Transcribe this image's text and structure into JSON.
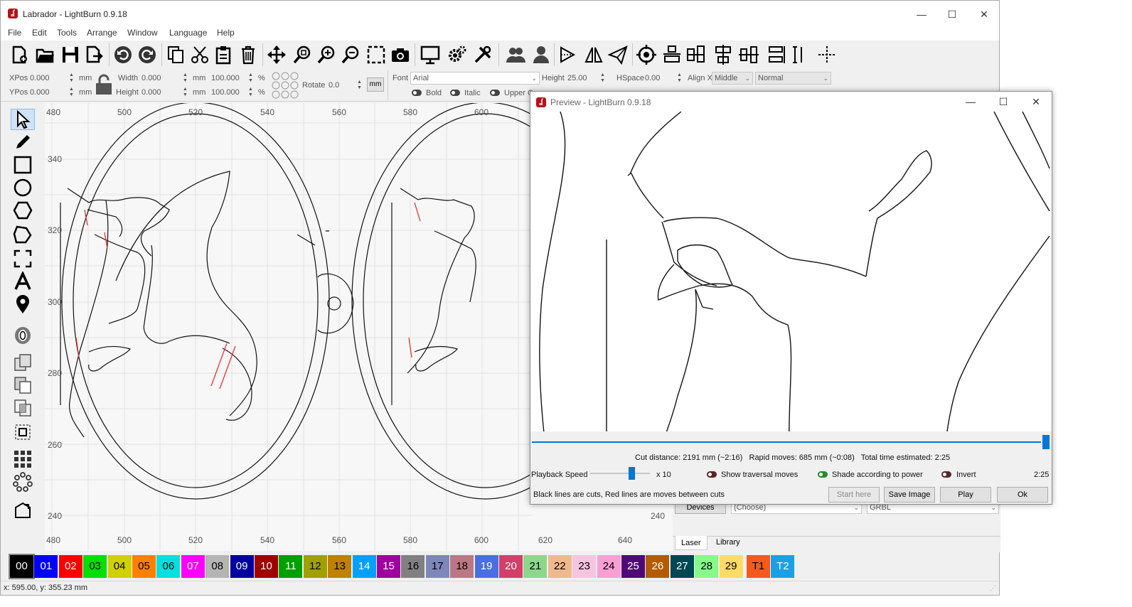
{
  "app": {
    "title": "Labrador - LightBurn 0.9.18",
    "icon": "lightburn-logo-icon",
    "window_controls": [
      "minimize-icon",
      "maximize-icon",
      "close-icon"
    ]
  },
  "menu": [
    "File",
    "Edit",
    "Tools",
    "Arrange",
    "Window",
    "Language",
    "Help"
  ],
  "toolbar_icons": [
    "new-file-icon",
    "open-folder-icon",
    "save-icon",
    "export-icon",
    "undo-icon",
    "redo-icon",
    "copy-icon",
    "cut-icon",
    "paste-icon",
    "delete-icon",
    "move-icon",
    "zoom-to-page-icon",
    "zoom-in-icon",
    "zoom-out-icon",
    "select-frame-icon",
    "camera-icon",
    "monitor-icon",
    "settings-icon",
    "tools-icon",
    "group-icon",
    "ungroup-icon",
    "mirror-horizontal-icon",
    "mirror-vertical-icon",
    "send-icon",
    "target-icon",
    "align-left-icon",
    "align-center-icon",
    "align-right-icon",
    "align-top-icon",
    "distribute-icon",
    "dock-icon"
  ],
  "props": {
    "xpos_label": "XPos",
    "xpos_value": "0.000",
    "xpos_unit": "mm",
    "ypos_label": "YPos",
    "ypos_value": "0.000",
    "ypos_unit": "mm",
    "width_label": "Width",
    "width_value": "0.000",
    "width_unit": "mm",
    "width_pct": "100.000",
    "pct": "%",
    "height_label": "Height",
    "height_value": "0.000",
    "height_unit": "mm",
    "height_pct": "100.000",
    "rotate_label": "Rotate",
    "rotate_value": "0.0",
    "unit_button": "mm",
    "font_label": "Font",
    "font_value": "Arial",
    "font_height_label": "Height",
    "font_height_value": "25.00",
    "hspace_label": "HSpace",
    "hspace_value": "0.00",
    "alignx_label": "Align X",
    "alignx_value": "Middle",
    "style_value": "Normal",
    "bold_label": "Bold",
    "italic_label": "Italic",
    "upper_label": "Upper C"
  },
  "left_tools": [
    "select-arrow-icon",
    "pencil-icon",
    "rectangle-icon",
    "ellipse-icon",
    "polygon-icon",
    "polygon-edit-icon",
    "frame-icon",
    "text-icon",
    "position-pin-icon",
    "offset-icon",
    "boolean-union-icon",
    "boolean-subtract-icon",
    "boolean-intersect-icon",
    "weld-icon",
    "grid-array-icon",
    "circular-array-icon",
    "edit-nodes-icon"
  ],
  "ruler": {
    "x_top": [
      "480",
      "500",
      "520",
      "540",
      "560",
      "580",
      "600"
    ],
    "x_bottom": [
      "480",
      "500",
      "520",
      "540",
      "560",
      "580",
      "600",
      "620",
      "640"
    ],
    "y": [
      "340",
      "320",
      "300",
      "280",
      "260",
      "240"
    ],
    "y_right": "240"
  },
  "palette": [
    {
      "label": "00",
      "bg": "#000000",
      "fg": "#ffffff"
    },
    {
      "label": "01",
      "bg": "#0000ff",
      "fg": "#ffffff"
    },
    {
      "label": "02",
      "bg": "#ff0000",
      "fg": "#ffffff"
    },
    {
      "label": "03",
      "bg": "#00e000",
      "fg": "#000000"
    },
    {
      "label": "04",
      "bg": "#d0d000",
      "fg": "#000000"
    },
    {
      "label": "05",
      "bg": "#ff8000",
      "fg": "#000000"
    },
    {
      "label": "06",
      "bg": "#00e0e0",
      "fg": "#000000"
    },
    {
      "label": "07",
      "bg": "#ff00ff",
      "fg": "#ffffff"
    },
    {
      "label": "08",
      "bg": "#b4b4b4",
      "fg": "#000000"
    },
    {
      "label": "09",
      "bg": "#0000a0",
      "fg": "#ffffff"
    },
    {
      "label": "10",
      "bg": "#a00000",
      "fg": "#ffffff"
    },
    {
      "label": "11",
      "bg": "#00a000",
      "fg": "#ffffff"
    },
    {
      "label": "12",
      "bg": "#a0a000",
      "fg": "#000000"
    },
    {
      "label": "13",
      "bg": "#c08000",
      "fg": "#000000"
    },
    {
      "label": "14",
      "bg": "#00a0ff",
      "fg": "#ffffff"
    },
    {
      "label": "15",
      "bg": "#a000a0",
      "fg": "#ffffff"
    },
    {
      "label": "16",
      "bg": "#808080",
      "fg": "#000000"
    },
    {
      "label": "17",
      "bg": "#7d87b9",
      "fg": "#000000"
    },
    {
      "label": "18",
      "bg": "#bb7784",
      "fg": "#000000"
    },
    {
      "label": "19",
      "bg": "#4a6fe3",
      "fg": "#ffffff"
    },
    {
      "label": "20",
      "bg": "#d33f6a",
      "fg": "#ffffff"
    },
    {
      "label": "21",
      "bg": "#8cd78c",
      "fg": "#000000"
    },
    {
      "label": "22",
      "bg": "#f0b98d",
      "fg": "#000000"
    },
    {
      "label": "23",
      "bg": "#f6c4e1",
      "fg": "#000000"
    },
    {
      "label": "24",
      "bg": "#fa9ed4",
      "fg": "#000000"
    },
    {
      "label": "25",
      "bg": "#500a78",
      "fg": "#ffffff"
    },
    {
      "label": "26",
      "bg": "#b45a00",
      "fg": "#ffffff"
    },
    {
      "label": "27",
      "bg": "#004754",
      "fg": "#ffffff"
    },
    {
      "label": "28",
      "bg": "#86fa88",
      "fg": "#000000"
    },
    {
      "label": "29",
      "bg": "#ffdb66",
      "fg": "#000000"
    },
    {
      "label": "T1",
      "bg": "#f35b1e",
      "fg": "#000000"
    },
    {
      "label": "T2",
      "bg": "#1ba0e6",
      "fg": "#ffffff"
    }
  ],
  "status": {
    "coords": "x: 595.00, y: 355.23 mm"
  },
  "right_panel": {
    "devices_button": "Devices",
    "device_select": "(Choose)",
    "controller_select": "GRBL",
    "tabs": [
      "Laser",
      "Library"
    ]
  },
  "preview": {
    "title": "Preview - LightBurn 0.9.18",
    "stats": "Cut distance: 2191 mm (~2:16)   Rapid moves: 685 mm (~0:08)   Total time estimated: 2:25",
    "playback_label": "Playback Speed",
    "playback_multiplier": "x 10",
    "playback_speed": 0.35,
    "progress": 1.0,
    "show_traversal_label": "Show traversal moves",
    "shade_label": "Shade according to power",
    "invert_label": "Invert",
    "time": "2:25",
    "legend": "Black lines are cuts, Red lines are moves between cuts",
    "start_here": "Start here",
    "save_image": "Save Image",
    "play": "Play",
    "ok": "Ok",
    "accent": "#0078d7"
  }
}
